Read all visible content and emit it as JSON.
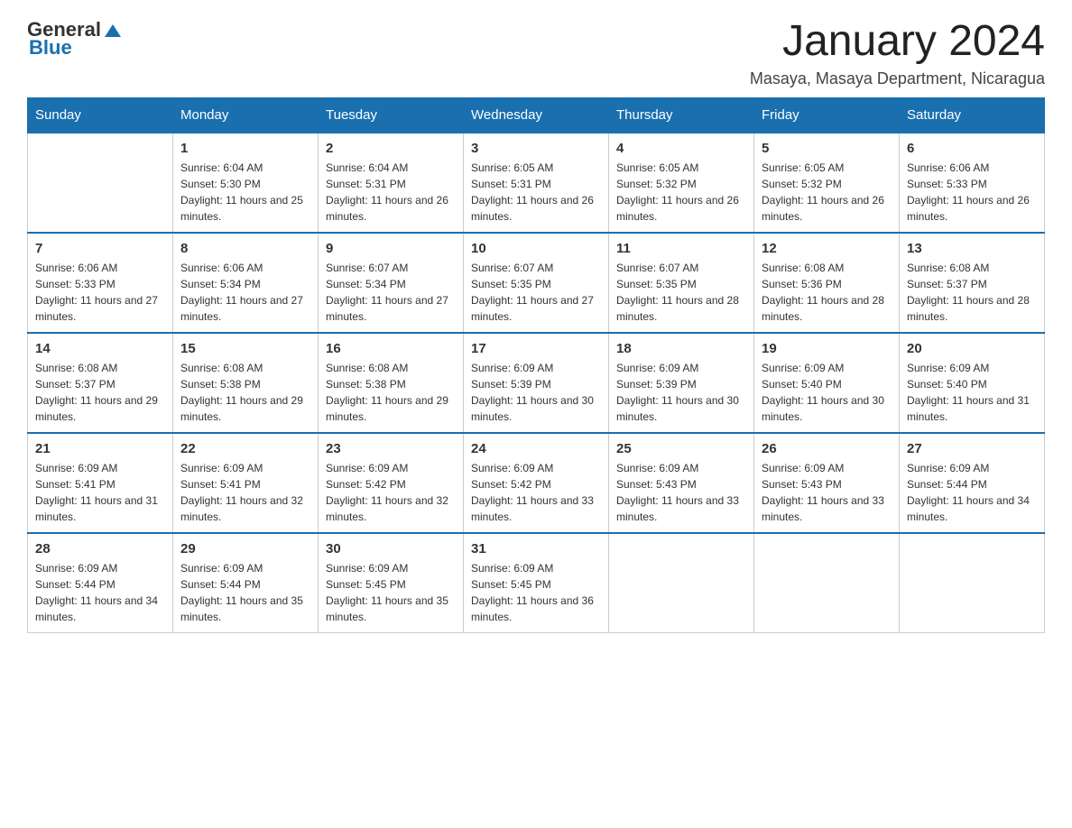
{
  "logo": {
    "general": "General",
    "blue": "Blue"
  },
  "title": "January 2024",
  "location": "Masaya, Masaya Department, Nicaragua",
  "weekdays": [
    "Sunday",
    "Monday",
    "Tuesday",
    "Wednesday",
    "Thursday",
    "Friday",
    "Saturday"
  ],
  "weeks": [
    [
      {
        "day": "",
        "info": ""
      },
      {
        "day": "1",
        "info": "Sunrise: 6:04 AM\nSunset: 5:30 PM\nDaylight: 11 hours and 25 minutes."
      },
      {
        "day": "2",
        "info": "Sunrise: 6:04 AM\nSunset: 5:31 PM\nDaylight: 11 hours and 26 minutes."
      },
      {
        "day": "3",
        "info": "Sunrise: 6:05 AM\nSunset: 5:31 PM\nDaylight: 11 hours and 26 minutes."
      },
      {
        "day": "4",
        "info": "Sunrise: 6:05 AM\nSunset: 5:32 PM\nDaylight: 11 hours and 26 minutes."
      },
      {
        "day": "5",
        "info": "Sunrise: 6:05 AM\nSunset: 5:32 PM\nDaylight: 11 hours and 26 minutes."
      },
      {
        "day": "6",
        "info": "Sunrise: 6:06 AM\nSunset: 5:33 PM\nDaylight: 11 hours and 26 minutes."
      }
    ],
    [
      {
        "day": "7",
        "info": "Sunrise: 6:06 AM\nSunset: 5:33 PM\nDaylight: 11 hours and 27 minutes."
      },
      {
        "day": "8",
        "info": "Sunrise: 6:06 AM\nSunset: 5:34 PM\nDaylight: 11 hours and 27 minutes."
      },
      {
        "day": "9",
        "info": "Sunrise: 6:07 AM\nSunset: 5:34 PM\nDaylight: 11 hours and 27 minutes."
      },
      {
        "day": "10",
        "info": "Sunrise: 6:07 AM\nSunset: 5:35 PM\nDaylight: 11 hours and 27 minutes."
      },
      {
        "day": "11",
        "info": "Sunrise: 6:07 AM\nSunset: 5:35 PM\nDaylight: 11 hours and 28 minutes."
      },
      {
        "day": "12",
        "info": "Sunrise: 6:08 AM\nSunset: 5:36 PM\nDaylight: 11 hours and 28 minutes."
      },
      {
        "day": "13",
        "info": "Sunrise: 6:08 AM\nSunset: 5:37 PM\nDaylight: 11 hours and 28 minutes."
      }
    ],
    [
      {
        "day": "14",
        "info": "Sunrise: 6:08 AM\nSunset: 5:37 PM\nDaylight: 11 hours and 29 minutes."
      },
      {
        "day": "15",
        "info": "Sunrise: 6:08 AM\nSunset: 5:38 PM\nDaylight: 11 hours and 29 minutes."
      },
      {
        "day": "16",
        "info": "Sunrise: 6:08 AM\nSunset: 5:38 PM\nDaylight: 11 hours and 29 minutes."
      },
      {
        "day": "17",
        "info": "Sunrise: 6:09 AM\nSunset: 5:39 PM\nDaylight: 11 hours and 30 minutes."
      },
      {
        "day": "18",
        "info": "Sunrise: 6:09 AM\nSunset: 5:39 PM\nDaylight: 11 hours and 30 minutes."
      },
      {
        "day": "19",
        "info": "Sunrise: 6:09 AM\nSunset: 5:40 PM\nDaylight: 11 hours and 30 minutes."
      },
      {
        "day": "20",
        "info": "Sunrise: 6:09 AM\nSunset: 5:40 PM\nDaylight: 11 hours and 31 minutes."
      }
    ],
    [
      {
        "day": "21",
        "info": "Sunrise: 6:09 AM\nSunset: 5:41 PM\nDaylight: 11 hours and 31 minutes."
      },
      {
        "day": "22",
        "info": "Sunrise: 6:09 AM\nSunset: 5:41 PM\nDaylight: 11 hours and 32 minutes."
      },
      {
        "day": "23",
        "info": "Sunrise: 6:09 AM\nSunset: 5:42 PM\nDaylight: 11 hours and 32 minutes."
      },
      {
        "day": "24",
        "info": "Sunrise: 6:09 AM\nSunset: 5:42 PM\nDaylight: 11 hours and 33 minutes."
      },
      {
        "day": "25",
        "info": "Sunrise: 6:09 AM\nSunset: 5:43 PM\nDaylight: 11 hours and 33 minutes."
      },
      {
        "day": "26",
        "info": "Sunrise: 6:09 AM\nSunset: 5:43 PM\nDaylight: 11 hours and 33 minutes."
      },
      {
        "day": "27",
        "info": "Sunrise: 6:09 AM\nSunset: 5:44 PM\nDaylight: 11 hours and 34 minutes."
      }
    ],
    [
      {
        "day": "28",
        "info": "Sunrise: 6:09 AM\nSunset: 5:44 PM\nDaylight: 11 hours and 34 minutes."
      },
      {
        "day": "29",
        "info": "Sunrise: 6:09 AM\nSunset: 5:44 PM\nDaylight: 11 hours and 35 minutes."
      },
      {
        "day": "30",
        "info": "Sunrise: 6:09 AM\nSunset: 5:45 PM\nDaylight: 11 hours and 35 minutes."
      },
      {
        "day": "31",
        "info": "Sunrise: 6:09 AM\nSunset: 5:45 PM\nDaylight: 11 hours and 36 minutes."
      },
      {
        "day": "",
        "info": ""
      },
      {
        "day": "",
        "info": ""
      },
      {
        "day": "",
        "info": ""
      }
    ]
  ]
}
